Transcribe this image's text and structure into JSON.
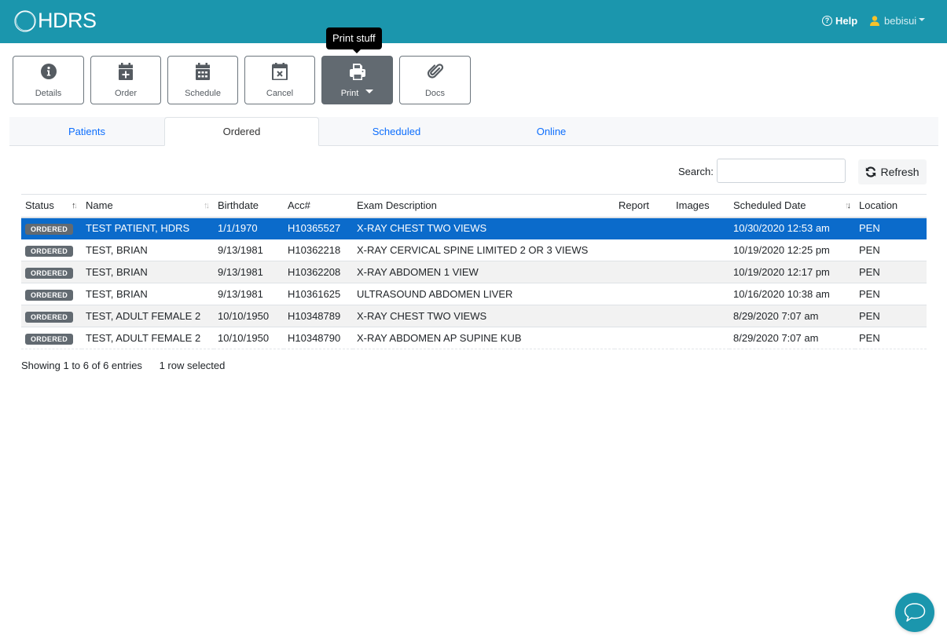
{
  "header": {
    "logo_text": "HDRS",
    "help_label": "Help",
    "user_name": "bebisui",
    "colors": {
      "bar": "#1b96ad",
      "user_icon": "#f6c22b"
    }
  },
  "toolbar": {
    "buttons": [
      {
        "label": "Details",
        "icon": "info-circle-icon"
      },
      {
        "label": "Order",
        "icon": "calendar-plus-icon"
      },
      {
        "label": "Schedule",
        "icon": "calendar-icon"
      },
      {
        "label": "Cancel",
        "icon": "calendar-x-icon"
      },
      {
        "label": "Print",
        "icon": "printer-icon",
        "active": true,
        "dropdown": true
      },
      {
        "label": "Docs",
        "icon": "paperclip-icon"
      }
    ],
    "tooltip": "Print stuff"
  },
  "tabs": [
    {
      "label": "Patients",
      "active": false
    },
    {
      "label": "Ordered",
      "active": true
    },
    {
      "label": "Scheduled",
      "active": false
    },
    {
      "label": "Online",
      "active": false
    }
  ],
  "search": {
    "label": "Search:",
    "value": "",
    "placeholder": ""
  },
  "refresh_label": "Refresh",
  "table": {
    "columns": [
      "Status",
      "Name",
      "Birthdate",
      "Acc#",
      "Exam Description",
      "Report",
      "Images",
      "Scheduled Date",
      "Location"
    ],
    "rows": [
      {
        "status": "ORDERED",
        "name": "TEST PATIENT, HDRS",
        "birthdate": "1/1/1970",
        "acc": "H10365527",
        "exam": "X-RAY CHEST TWO VIEWS",
        "report": "",
        "images": "",
        "scheduled": "10/30/2020 12:53 am",
        "location": "PEN",
        "selected": true
      },
      {
        "status": "ORDERED",
        "name": "TEST, BRIAN",
        "birthdate": "9/13/1981",
        "acc": "H10362218",
        "exam": "X-RAY CERVICAL SPINE LIMITED 2 OR 3 VIEWS",
        "report": "",
        "images": "",
        "scheduled": "10/19/2020 12:25 pm",
        "location": "PEN"
      },
      {
        "status": "ORDERED",
        "name": "TEST, BRIAN",
        "birthdate": "9/13/1981",
        "acc": "H10362208",
        "exam": "X-RAY ABDOMEN 1 VIEW",
        "report": "",
        "images": "",
        "scheduled": "10/19/2020 12:17 pm",
        "location": "PEN"
      },
      {
        "status": "ORDERED",
        "name": "TEST, BRIAN",
        "birthdate": "9/13/1981",
        "acc": "H10361625",
        "exam": "ULTRASOUND ABDOMEN LIVER",
        "report": "",
        "images": "",
        "scheduled": "10/16/2020 10:38 am",
        "location": "PEN"
      },
      {
        "status": "ORDERED",
        "name": "TEST, ADULT FEMALE 2",
        "birthdate": "10/10/1950",
        "acc": "H10348789",
        "exam": "X-RAY CHEST TWO VIEWS",
        "report": "",
        "images": "",
        "scheduled": "8/29/2020 7:07 am",
        "location": "PEN"
      },
      {
        "status": "ORDERED",
        "name": "TEST, ADULT FEMALE 2",
        "birthdate": "10/10/1950",
        "acc": "H10348790",
        "exam": "X-RAY ABDOMEN AP SUPINE KUB",
        "report": "",
        "images": "",
        "scheduled": "8/29/2020 7:07 am",
        "location": "PEN"
      }
    ]
  },
  "footer": {
    "showing": "Showing 1 to 6 of 6 entries",
    "selected": "1 row selected"
  }
}
